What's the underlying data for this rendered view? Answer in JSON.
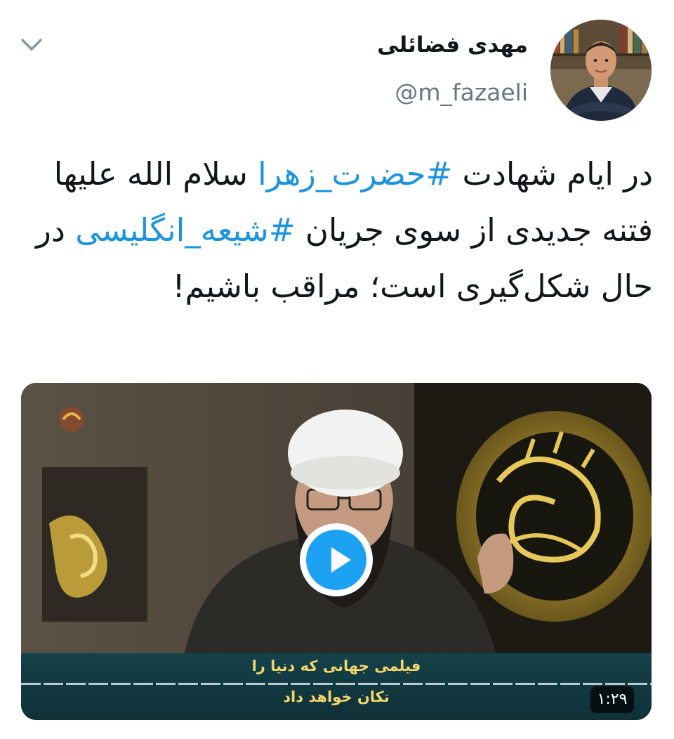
{
  "tweet": {
    "author": {
      "display_name": "مهدی فضائلی",
      "handle": "@m_fazaeli"
    },
    "text": {
      "line1_prefix": "در ایام شهادت ",
      "hashtag1": "#حضرت_زهرا",
      "line1_suffix": " سلام الله علیها فتنه جدیدی از سوی جریان ",
      "hashtag2": "#شیعه_انگلیسی",
      "line2_suffix": " در حال شکل‌گیری است؛ مراقب باشیم!"
    },
    "media": {
      "subtitle_line1": "فیلمی جهانی که دنیا را",
      "subtitle_line2": "تکان خواهد داد",
      "duration": "۱:۲۹"
    },
    "icons": {
      "menu": "chevron-down-icon",
      "play": "play-icon"
    },
    "colors": {
      "hashtag": "#1b95e0",
      "play_button": "#1da1f2",
      "handle": "#657786"
    }
  }
}
